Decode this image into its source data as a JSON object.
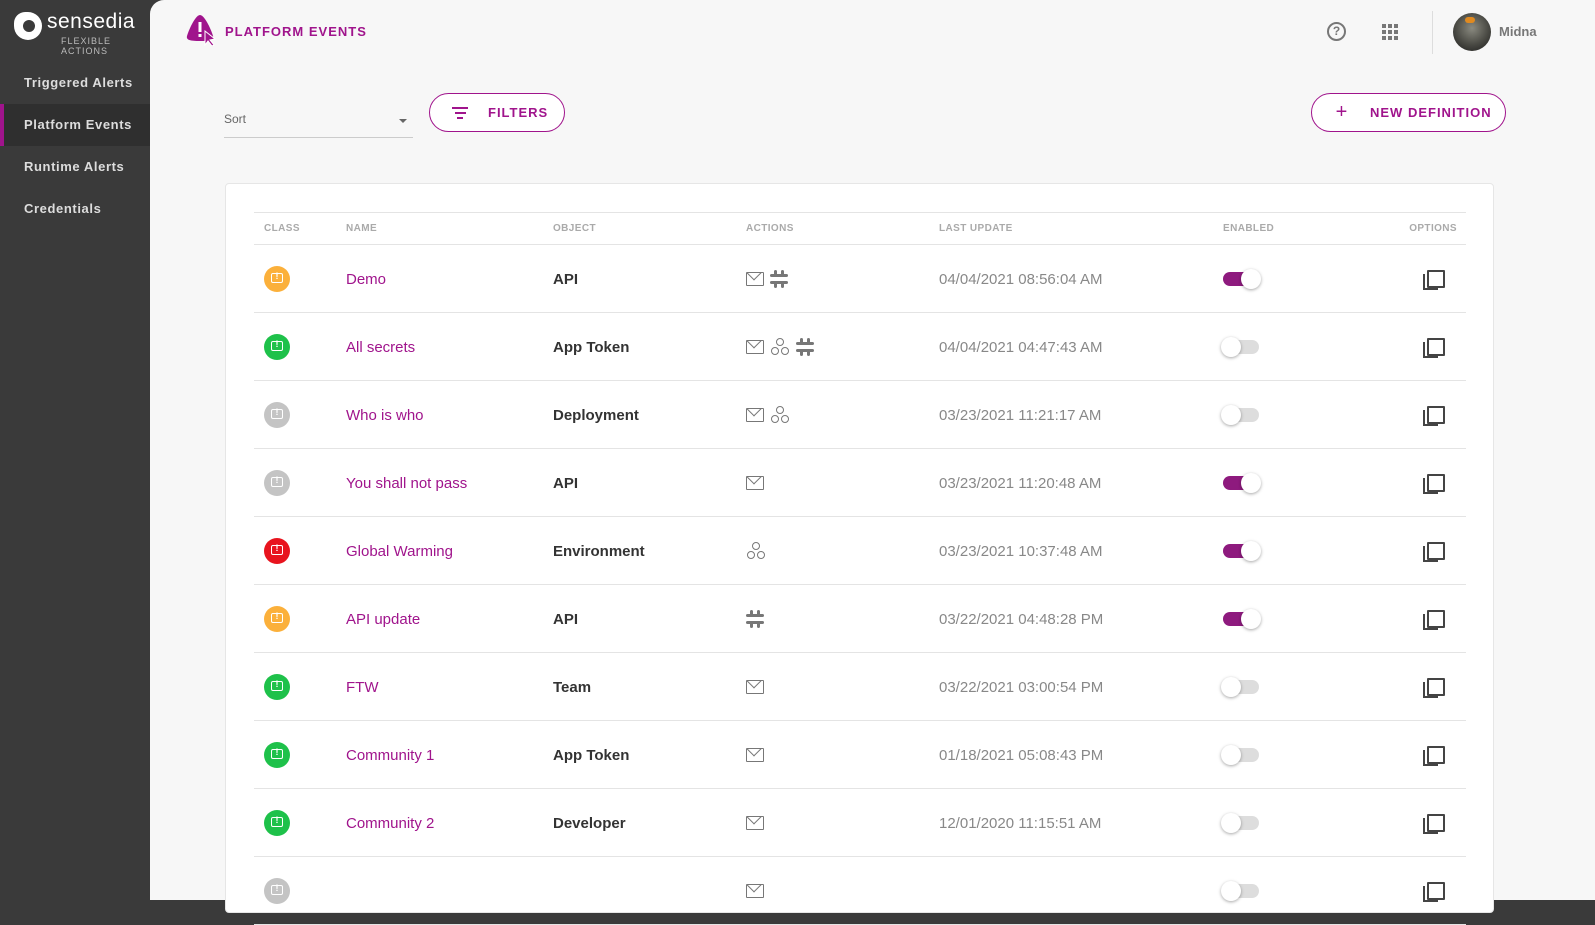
{
  "brand": {
    "name": "sensedia",
    "subtitle": "FLEXIBLE ACTIONS"
  },
  "sidebar": {
    "items": [
      {
        "label": "Triggered Alerts",
        "active": false
      },
      {
        "label": "Platform Events",
        "active": true
      },
      {
        "label": "Runtime Alerts",
        "active": false
      },
      {
        "label": "Credentials",
        "active": false
      }
    ]
  },
  "header": {
    "title": "PLATFORM EVENTS",
    "help_icon": "help-circle-icon",
    "apps_icon": "apps-grid-icon",
    "user": "Midna"
  },
  "toolbar": {
    "sort_placeholder": "Sort",
    "filters_label": "FILTERS",
    "new_definition_label": "NEW DEFINITION"
  },
  "colors": {
    "accent": "#a0148c",
    "warning": "#fbb03b",
    "success": "#1ec14a",
    "inactive": "#c4c4c4",
    "critical": "#e8141e"
  },
  "table": {
    "columns": [
      "CLASS",
      "NAME",
      "OBJECT",
      "ACTIONS",
      "LAST UPDATE",
      "ENABLED",
      "OPTIONS"
    ],
    "rows": [
      {
        "class": "warning",
        "name": "Demo",
        "object": "API",
        "actions": [
          "email",
          "slack"
        ],
        "last_update": "04/04/2021 08:56:04 AM",
        "enabled": true
      },
      {
        "class": "success",
        "name": "All secrets",
        "object": "App Token",
        "actions": [
          "email",
          "webhook",
          "slack"
        ],
        "last_update": "04/04/2021 04:47:43 AM",
        "enabled": false
      },
      {
        "class": "inactive",
        "name": "Who is who",
        "object": "Deployment",
        "actions": [
          "email",
          "webhook"
        ],
        "last_update": "03/23/2021 11:21:17 AM",
        "enabled": false
      },
      {
        "class": "inactive",
        "name": "You shall not pass",
        "object": "API",
        "actions": [
          "email"
        ],
        "last_update": "03/23/2021 11:20:48 AM",
        "enabled": true
      },
      {
        "class": "critical",
        "name": "Global Warming",
        "object": "Environment",
        "actions": [
          "webhook"
        ],
        "last_update": "03/23/2021 10:37:48 AM",
        "enabled": true
      },
      {
        "class": "warning",
        "name": "API update",
        "object": "API",
        "actions": [
          "slack"
        ],
        "last_update": "03/22/2021 04:48:28 PM",
        "enabled": true
      },
      {
        "class": "success",
        "name": "FTW",
        "object": "Team",
        "actions": [
          "email"
        ],
        "last_update": "03/22/2021 03:00:54 PM",
        "enabled": false
      },
      {
        "class": "success",
        "name": "Community 1",
        "object": "App Token",
        "actions": [
          "email"
        ],
        "last_update": "01/18/2021 05:08:43 PM",
        "enabled": false
      },
      {
        "class": "success",
        "name": "Community 2",
        "object": "Developer",
        "actions": [
          "email"
        ],
        "last_update": "12/01/2020 11:15:51 AM",
        "enabled": false
      },
      {
        "class": "inactive",
        "name": "",
        "object": "",
        "actions": [
          "email"
        ],
        "last_update": "",
        "enabled": false
      }
    ]
  }
}
